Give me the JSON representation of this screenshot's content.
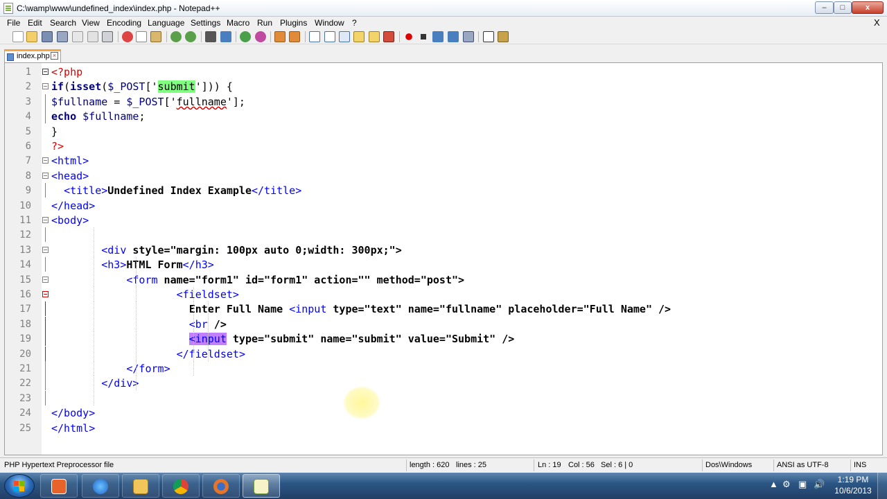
{
  "window": {
    "title": "C:\\wamp\\www\\undefined_index\\index.php - Notepad++",
    "min_label": "–",
    "max_label": "□",
    "close_label": "x"
  },
  "menu": {
    "items": [
      "File",
      "Edit",
      "Search",
      "View",
      "Encoding",
      "Language",
      "Settings",
      "Macro",
      "Run",
      "Plugins",
      "Window",
      "?"
    ],
    "close_label": "X"
  },
  "tab": {
    "label": "index.php"
  },
  "editor": {
    "line_numbers": [
      "1",
      "2",
      "3",
      "4",
      "5",
      "6",
      "7",
      "8",
      "9",
      "10",
      "11",
      "12",
      "13",
      "14",
      "15",
      "16",
      "17",
      "18",
      "19",
      "20",
      "21",
      "22",
      "23",
      "24",
      "25"
    ],
    "lines": [
      "<?php",
      "if(isset($_POST['submit'])) {",
      "$fullname = $_POST['fullname'];",
      "echo $fullname;",
      "}",
      "?>",
      "<html>",
      "<head>",
      "  <title>Undefined Index Example</title>",
      "</head>",
      "<body>",
      "",
      "        <div style=\"margin: 100px auto 0;width: 300px;\">",
      "        <h3>HTML Form</h3>",
      "            <form name=\"form1\" id=\"form1\" action=\"\" method=\"post\">",
      "                    <fieldset>",
      "                      Enter Full Name <input type=\"text\" name=\"fullname\" placeholder=\"Full Name\" />",
      "                      <br />",
      "                      <input type=\"submit\" name=\"submit\" value=\"Submit\" />",
      "                    </fieldset>",
      "            </form>",
      "        </div>",
      "",
      "</body>",
      "</html>"
    ]
  },
  "status": {
    "file_type": "PHP Hypertext Preprocessor file",
    "length": "length : 620",
    "lines": "lines : 25",
    "ln": "Ln : 19",
    "col": "Col : 56",
    "sel": "Sel : 6 | 0",
    "eol": "Dos\\Windows",
    "encoding": "ANSI as UTF-8",
    "mode": "INS"
  },
  "taskbar": {
    "apps": [
      "media-player-icon",
      "internet-explorer-icon",
      "file-explorer-icon",
      "chrome-icon",
      "firefox-icon",
      "notepadpp-icon"
    ],
    "time": "1:19 PM",
    "date": "10/6/2013"
  },
  "colors": {
    "php_tag": "#d80000",
    "keyword": "#000080",
    "html_tag": "#0000ff",
    "attribute": "#ff0000",
    "attr_value": "#8000ff",
    "match_highlight": "#80ff80",
    "tag_highlight": "#c080ff"
  }
}
